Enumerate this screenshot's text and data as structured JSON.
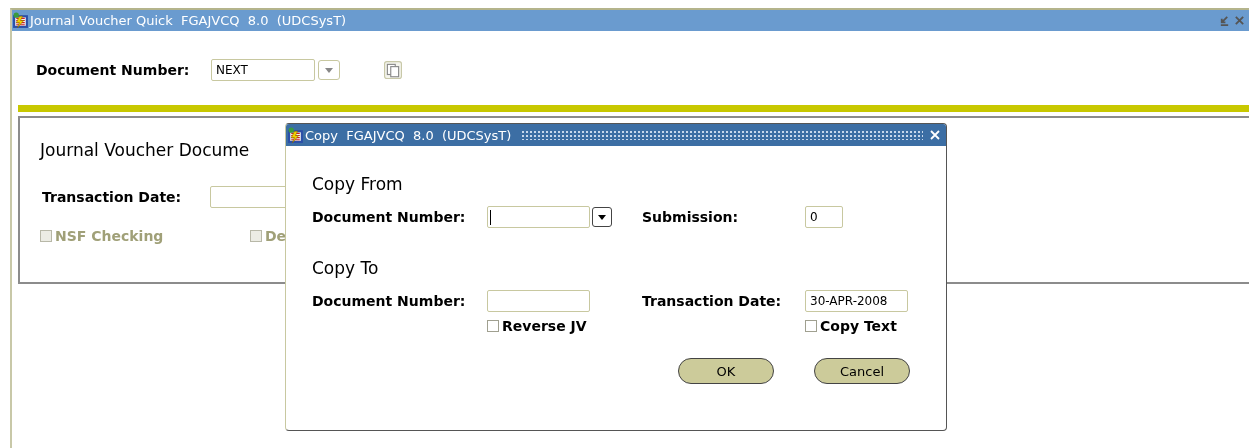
{
  "window": {
    "title": "Journal Voucher Quick  FGAJVCQ  8.0  (UDCSysT)"
  },
  "key_block": {
    "label": "Document Number:",
    "value": "NEXT"
  },
  "main_form": {
    "heading": "Journal Voucher Docume",
    "transaction_date_label": "Transaction Date:",
    "checkboxes": [
      {
        "label": "NSF Checking",
        "checked": false,
        "disabled": true
      },
      {
        "label": "De",
        "checked": false,
        "disabled": true
      }
    ]
  },
  "dialog": {
    "title": "Copy  FGAJVCQ  8.0  (UDCSysT)",
    "copy_from": {
      "heading": "Copy From",
      "document_number_label": "Document Number:",
      "submission_label": "Submission:",
      "submission_value": "0"
    },
    "copy_to": {
      "heading": "Copy To",
      "document_number_label": "Document Number:",
      "transaction_date_label": "Transaction Date:",
      "transaction_date_value": "30-APR-2008",
      "checkboxes": [
        {
          "label": "Reverse JV",
          "checked": false,
          "disabled": false
        },
        {
          "label": "Copy Text",
          "checked": false,
          "disabled": false
        }
      ]
    },
    "buttons": [
      "OK",
      "Cancel"
    ]
  }
}
